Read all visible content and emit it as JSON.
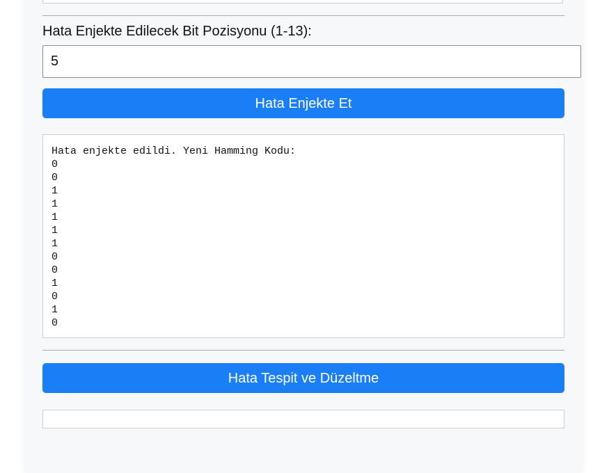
{
  "form": {
    "bit_position_label": "Hata Enjekte Edilecek Bit Pozisyonu (1-13):",
    "bit_position_value": "5"
  },
  "buttons": {
    "inject_label": "Hata Enjekte Et",
    "detect_label": "Hata Tespit ve Düzeltme"
  },
  "injection_output": {
    "heading": "Hata enjekte edildi. Yeni Hamming Kodu:",
    "bits": [
      "0",
      "0",
      "1",
      "1",
      "1",
      "1",
      "1",
      "0",
      "0",
      "1",
      "0",
      "1",
      "0"
    ]
  },
  "detection_output": {
    "text": ""
  },
  "colors": {
    "accent": "#1a7ff7",
    "panel_background": "#f7f8fa"
  }
}
